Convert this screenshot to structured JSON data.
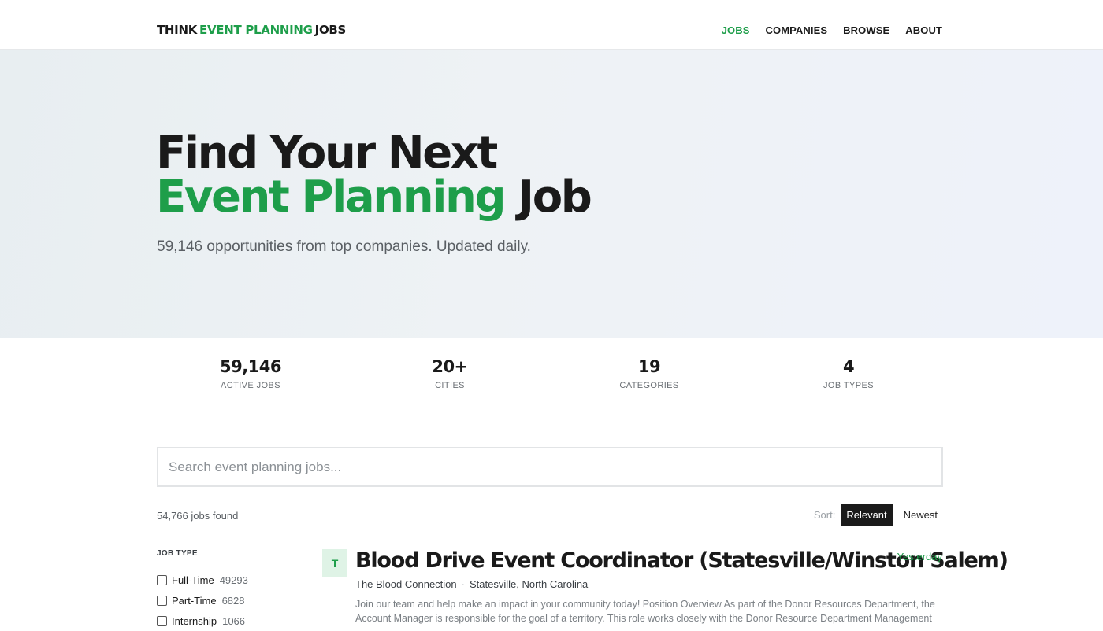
{
  "header": {
    "logo": {
      "part1": "THINK",
      "part2": "EVENT PLANNING",
      "part3": "JOBS"
    },
    "nav": [
      "JOBS",
      "COMPANIES",
      "BROWSE",
      "ABOUT"
    ],
    "active_nav": "JOBS"
  },
  "hero": {
    "line1": "Find Your Next",
    "line2_accent": "Event Planning",
    "line2_rest": "Job",
    "subtitle": "59,146 opportunities from top companies. Updated daily."
  },
  "stats": [
    {
      "value": "59,146",
      "label": "ACTIVE JOBS"
    },
    {
      "value": "20+",
      "label": "CITIES"
    },
    {
      "value": "19",
      "label": "CATEGORIES"
    },
    {
      "value": "4",
      "label": "JOB TYPES"
    }
  ],
  "search": {
    "placeholder": "Search event planning jobs...",
    "value": ""
  },
  "results": {
    "count_text": "54,766 jobs found",
    "sort_label": "Sort:",
    "sort_options": [
      "Relevant",
      "Newest"
    ],
    "sort_selected": "Relevant"
  },
  "filters": {
    "title": "JOB TYPE",
    "items": [
      {
        "label": "Full-Time",
        "count": "49293",
        "checked": false
      },
      {
        "label": "Part-Time",
        "count": "6828",
        "checked": false
      },
      {
        "label": "Internship",
        "count": "1066",
        "checked": false
      }
    ]
  },
  "job": {
    "avatar_letter": "T",
    "title": "Blood Drive Event Coordinator (Statesville/Winston Salem)",
    "company": "The Blood Connection",
    "separator": "·",
    "location": "Statesville, North Carolina",
    "date": "Yesterday",
    "description": "Join our team and help make an impact in your community today! Position Overview As part of the Donor Resources Department, the Account Manager is responsible for the goal of a territory. This role works closely with the Donor Resource Department Management to..."
  },
  "colors": {
    "accent": "#1e9e4a",
    "text": "#1a1a1a",
    "hero_bg": "#eef2f5",
    "avatar_bg": "#dff3e6"
  }
}
